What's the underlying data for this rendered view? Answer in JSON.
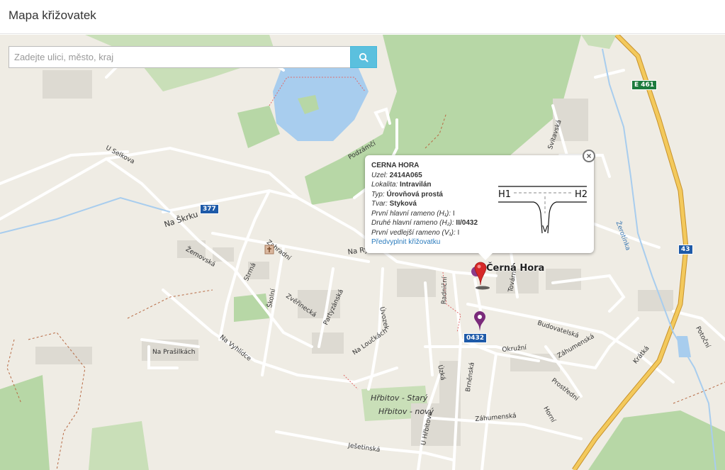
{
  "header": {
    "title": "Mapa křižovatek"
  },
  "search": {
    "placeholder": "Zadejte ulici, město, kraj",
    "button_icon": "search-icon"
  },
  "colors": {
    "accent": "#5bc0de",
    "marker_red": "#d62828",
    "marker_purple": "#7a2a7a",
    "road_shield": "#1e5aa8",
    "euro_shield": "#1c7b3e"
  },
  "map": {
    "place_label": "Černá Hora",
    "shields": {
      "road_377": "377",
      "road_43": "43",
      "euro": "E 461",
      "junction": "0432"
    },
    "streets": {
      "u_selkova": "U Selkova",
      "na_skrku": "Na Škrku",
      "zemovska": "Žemovská",
      "zahradni": "Zahradní",
      "na_rybnicku": "Na Rybníčku",
      "strma": "Strmá",
      "skolni": "Školní",
      "zvejrnecka": "Zvěřinecká",
      "partyzanska": "Partyzánská",
      "uvozek": "Úvozek",
      "radnicni": "Radniční",
      "na_vyhlidce": "Na Vyhlídce",
      "na_prasilkach": "Na Prašilkách",
      "na_louckach": "Na Loučkách",
      "uzka": "Úzká",
      "brnenska": "Brněnská",
      "okruzni": "Okružní",
      "budovatelska": "Budovatelská",
      "zahumenska": "Záhumenská",
      "zahumenska2": "Záhumenská",
      "prostredni": "Prostřední",
      "horni": "Horní",
      "kratka": "Krátká",
      "u_hrbitova": "U Hřbitova",
      "jesetinska": "Ješetinská",
      "svitavska": "Svitavská",
      "tovarni": "Tovární",
      "podzamci": "Podzámčí",
      "zerotinka": "Žerotínka",
      "poticni": "Potoční",
      "br": "Br"
    },
    "cemeteries": {
      "old": "Hřbitov - Starý",
      "new": "Hřbitov - nový"
    }
  },
  "popup": {
    "title": "CERNA HORA",
    "rows": [
      {
        "label": "Uzel:",
        "value": "2414A065"
      },
      {
        "label": "Lokalita:",
        "value": "Intravilán"
      },
      {
        "label": "Typ:",
        "value": "Úrovňová prostá"
      },
      {
        "label": "Tvar:",
        "value": "Styková"
      }
    ],
    "plain_rows": [
      {
        "label": "První hlavní rameno (H₁):",
        "value": "I"
      },
      {
        "label": "Druhé hlavní rameno (H₂):",
        "value": "II/0432"
      },
      {
        "label": "První vedlejší rameno (V₁):",
        "value": "I"
      }
    ],
    "link": "Předvyplnit křižovatku",
    "close_symbol": "×",
    "diagram": {
      "h1": "H1",
      "h2": "H2",
      "v": "V"
    }
  }
}
